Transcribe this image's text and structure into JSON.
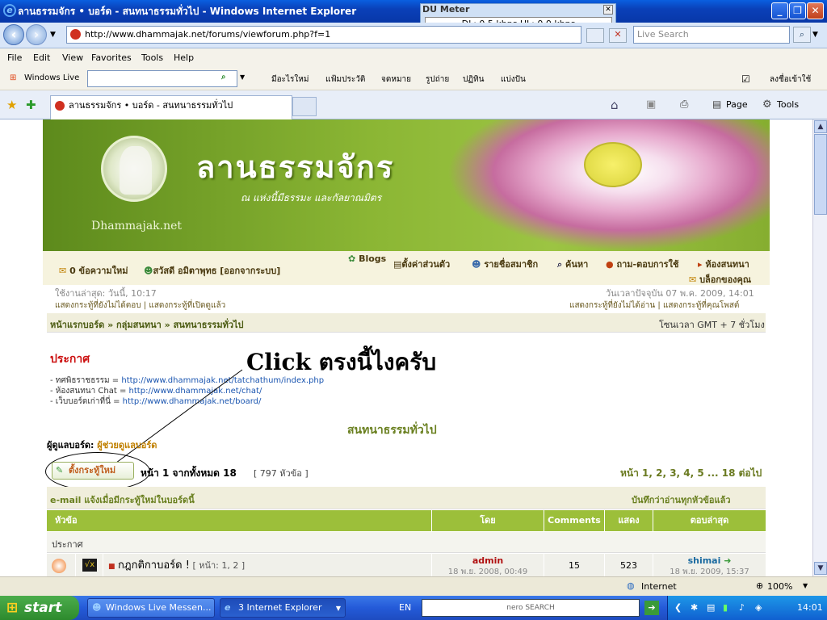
{
  "window": {
    "title": "ลานธรรมจักร • บอร์ด - สนทนาธรรมทั่วไป - Windows Internet Explorer"
  },
  "du_meter": {
    "title": "DU Meter",
    "readout": "DL: 0.5 kbps   UL: 0.0 kbps"
  },
  "address_bar": {
    "url": "http://www.dhammajak.net/forums/viewforum.php?f=1",
    "live_search_placeholder": "Live Search"
  },
  "menu": [
    "File",
    "Edit",
    "View",
    "Favorites",
    "Tools",
    "Help"
  ],
  "links_bar": {
    "windows_live": "Windows Live",
    "items": [
      "มีอะไรใหม่",
      "แฟ้มประวัติ",
      "จดหมาย",
      "รูปถ่าย",
      "ปฏิทิน",
      "แบ่งปัน"
    ],
    "signin": "ลงชื่อเข้าใช้"
  },
  "tabs": {
    "active": "ลานธรรมจักร • บอร์ด - สนทนาธรรมทั่วไป",
    "page_menu": "Page",
    "tools_menu": "Tools"
  },
  "site": {
    "title": "ลานธรรมจักร",
    "subtitle": "ณ แห่งนี้มีธรรมะ และกัลยาณมิตร",
    "name": "Dhammajak.net"
  },
  "nav": {
    "blogs": "Blogs",
    "messages": "0 ข้อความใหม่",
    "greeting": "สวัสดี อมิตาพุทธ [ออกจากระบบ]",
    "settings": "ตั้งค่าส่วนตัว",
    "members": "รายชื่อสมาชิก",
    "search": "ค้นหา",
    "faq": "ถาม-ตอบการใช้",
    "chat": "ห้องสนทนา",
    "blog_yours": "บล็อกของคุณ"
  },
  "info": {
    "last_visit": "ใช้งานล่าสุด: วันนี้, 10:17",
    "current_time": "วันเวลาปัจจุบัน 07 พ.ค. 2009, 14:01",
    "left_links": "แสดงกระทู้ที่ยังไม่ได้ตอบ | แสดงกระทู้ที่เปิดดูแล้ว",
    "right_links": "แสดงกระทู้ที่ยังไม่ได้อ่าน | แสดงกระทู้ที่คุณโพสต์"
  },
  "breadcrumb": {
    "path": "หน้าแรกบอร์ด » กลุ่มสนทนา » สนทนาธรรมทั่วไป",
    "timezone": "โซนเวลา GMT + 7 ชั่วโมง"
  },
  "announcement": {
    "heading": "ประกาศ",
    "lines": [
      {
        "label": "- ทศพิธราชธรรม = ",
        "url": "http://www.dhammajak.net/tatchathum/index.php"
      },
      {
        "label": "- ห้องสนทนา Chat = ",
        "url": "http://www.dhammajak.net/chat/"
      },
      {
        "label": "- เว็บบอร์ดเก่าที่นี่ = ",
        "url": "http://www.dhammajak.net/board/"
      }
    ]
  },
  "annotation": {
    "text": "Click ตรงนี้ไงครับ"
  },
  "forum": {
    "name": "สนทนาธรรมทั่วไป",
    "moderator_label": "ผู้ดูแลบอร์ด: ",
    "moderator": "ผู้ช่วยดูแลบอร์ด",
    "new_topic": "ตั้งกระทู้ใหม่",
    "page_info": "หน้า 1 จากทั้งหมด 18",
    "topic_count": "[ 797 หัวข้อ ]",
    "pagination": "หน้า 1, 2, 3, 4, 5 ... 18  ต่อไป",
    "email_notify": "e-mail แจ้งเมื่อมีกระทู้ใหม่ในบอร์ดนี้",
    "mark_read": "บันทึกว่าอ่านทุกหัวข้อแล้ว"
  },
  "table": {
    "headers": [
      "หัวข้อ",
      "โดย",
      "Comments",
      "แสดง",
      "ตอบล่าสุด"
    ],
    "section": "ประกาศ",
    "rows": [
      {
        "title": "กฎกติกาบอร์ด !",
        "pages_label": "[ หน้า: 1, 2 ]",
        "author": "admin",
        "author_date": "18 พ.ย. 2008, 00:49",
        "comments": "15",
        "views": "523",
        "last_user": "shimai",
        "last_date": "18 พ.ย. 2009, 15:37"
      }
    ]
  },
  "status": {
    "zone": "Internet",
    "zoom": "100%"
  },
  "taskbar": {
    "start": "start",
    "messenger": "Windows Live Messen...",
    "ie": "3 Internet Explorer",
    "lang": "EN",
    "nero": "nero SEARCH",
    "clock": "14:01"
  }
}
